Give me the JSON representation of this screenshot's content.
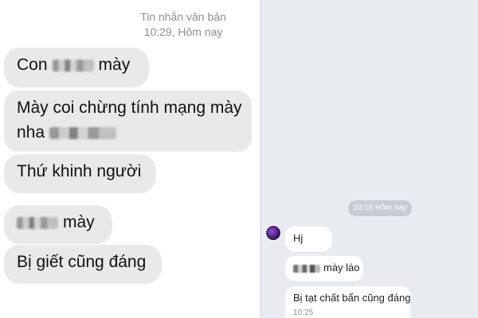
{
  "sms": {
    "header_title": "Tin nhắn văn bản",
    "header_time": "10:29, Hôm nay",
    "messages": [
      {
        "prefix": "Con",
        "suffix": "mày"
      },
      {
        "line1": "Mày coi chừng tính mạng mày",
        "line2": "nha"
      },
      {
        "text": "Thứ khinh người"
      },
      {
        "suffix": "mày"
      },
      {
        "text": "Bị giết cũng đáng"
      }
    ]
  },
  "chat": {
    "time_divider": "10:18 Hôm nay",
    "messages": [
      {
        "text": "Hj"
      },
      {
        "suffix": "mày láo"
      },
      {
        "text": "Bị tạt chất bẩn cũng đáng",
        "time": "10:25"
      }
    ]
  }
}
